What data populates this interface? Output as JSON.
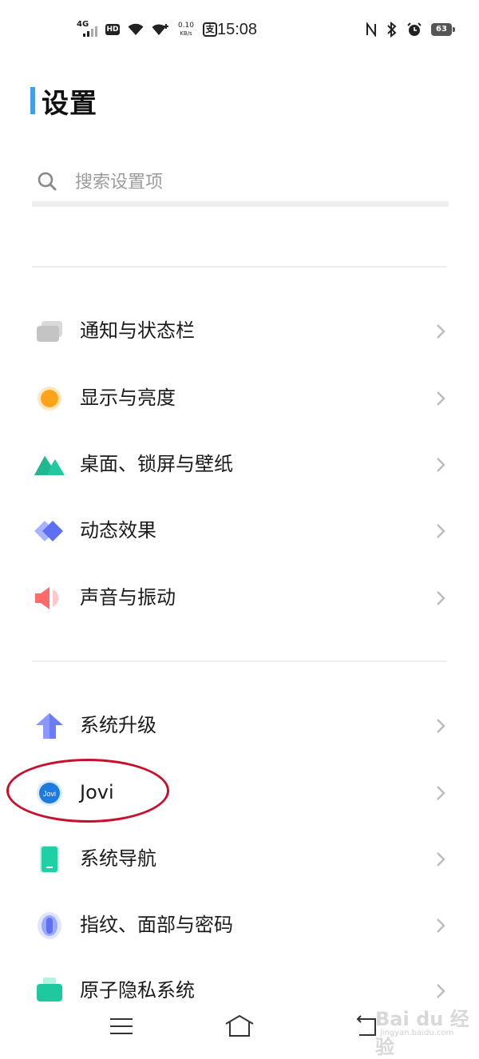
{
  "status_bar": {
    "network": "4G",
    "hd": "HD",
    "speed_value": "0.10",
    "speed_unit": "KB/s",
    "pay_glyph": "支",
    "time": "15:08",
    "battery": "63",
    "icons": [
      "nfc-icon",
      "bluetooth-icon",
      "alarm-icon"
    ]
  },
  "header": {
    "title": "设置",
    "accent": "#3aa1f0"
  },
  "search": {
    "placeholder": "搜索设置项"
  },
  "groups": [
    {
      "items": [
        {
          "label": "通知与状态栏",
          "icon": "notification-bar-icon"
        },
        {
          "label": "显示与亮度",
          "icon": "brightness-icon"
        },
        {
          "label": "桌面、锁屏与壁纸",
          "icon": "wallpaper-icon"
        },
        {
          "label": "动态效果",
          "icon": "animation-icon"
        },
        {
          "label": "声音与振动",
          "icon": "speaker-icon"
        }
      ]
    },
    {
      "items": [
        {
          "label": "系统升级",
          "icon": "upgrade-arrow-icon"
        },
        {
          "label": "Jovi",
          "icon": "jovi-icon",
          "highlighted": true
        },
        {
          "label": "系统导航",
          "icon": "phone-navigation-icon"
        },
        {
          "label": "指纹、面部与密码",
          "icon": "fingerprint-icon"
        },
        {
          "label": "原子隐私系统",
          "icon": "privacy-icon"
        }
      ]
    }
  ],
  "nav_bar": {
    "icons": [
      "menu-icon",
      "home-icon",
      "back-icon"
    ]
  },
  "watermark": {
    "text": "Bai du 经验",
    "url": "jingyan.baidu.com"
  },
  "annotation": {
    "color": "#c8102e"
  }
}
